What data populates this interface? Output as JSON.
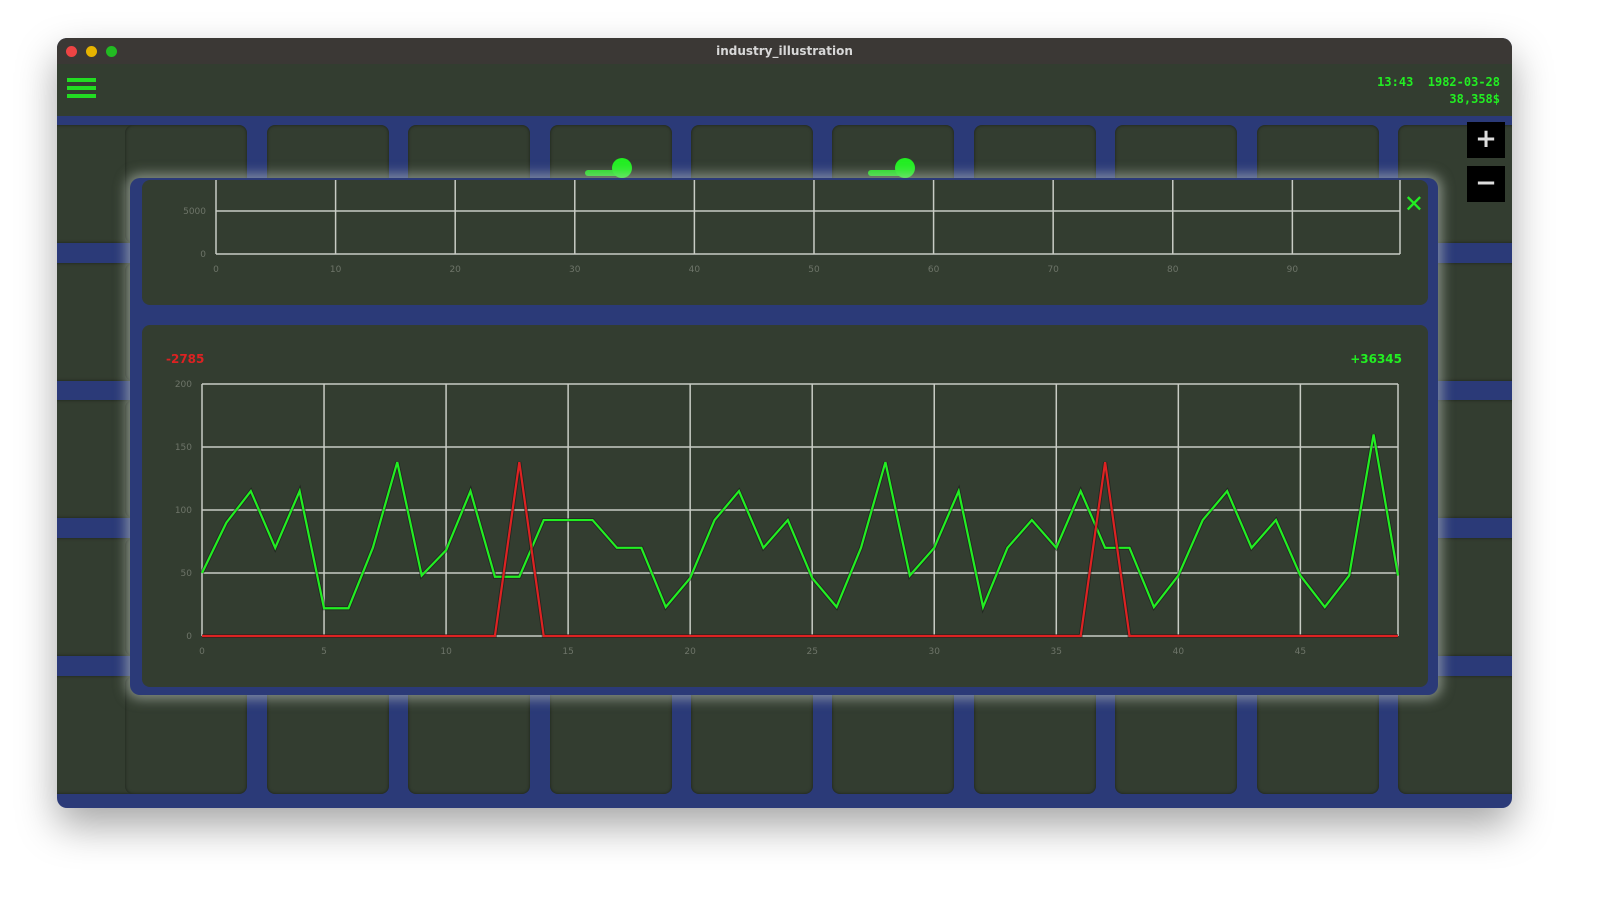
{
  "window": {
    "title": "industry_illustration"
  },
  "header": {
    "time": "13:43",
    "date": "1982-03-28",
    "balance": "38,358$",
    "menu_icon": "hamburger-icon"
  },
  "zoom": {
    "in_label": "+",
    "out_label": "−"
  },
  "overlay": {
    "close_label": "✕"
  },
  "colors": {
    "accent": "#22ee22",
    "negative": "#dd2222",
    "background": "#2b3a78",
    "panel": "#333d30"
  },
  "chart_data": [
    {
      "type": "line",
      "x_ticks": [
        0,
        10,
        20,
        30,
        40,
        50,
        60,
        70,
        80,
        90
      ],
      "y_ticks": [
        0,
        5000
      ],
      "xlim": [
        0,
        99
      ],
      "ylim": [
        0,
        5000
      ],
      "grid": true,
      "series": []
    },
    {
      "type": "line",
      "label_left": "-2785",
      "label_right": "+36345",
      "x_ticks": [
        0,
        5,
        10,
        15,
        20,
        25,
        30,
        35,
        40,
        45
      ],
      "y_ticks": [
        0,
        50,
        100,
        150,
        200
      ],
      "xlim": [
        0,
        49
      ],
      "ylim": [
        0,
        200
      ],
      "grid": true,
      "series": [
        {
          "color": "#22ee22",
          "values": [
            50,
            90,
            115,
            70,
            115,
            22,
            22,
            70,
            138,
            48,
            68,
            115,
            47,
            47,
            92,
            92,
            92,
            70,
            70,
            23,
            46,
            92,
            115,
            70,
            92,
            46,
            23,
            70,
            138,
            48,
            70,
            115,
            23,
            70,
            92,
            70,
            115,
            70,
            70,
            23,
            48,
            92,
            115,
            70,
            92,
            48,
            23,
            48,
            160,
            48
          ]
        },
        {
          "color": "#dd2222",
          "values": [
            0,
            0,
            0,
            0,
            0,
            0,
            0,
            0,
            0,
            0,
            0,
            0,
            0,
            138,
            0,
            0,
            0,
            0,
            0,
            0,
            0,
            0,
            0,
            0,
            0,
            0,
            0,
            0,
            0,
            0,
            0,
            0,
            0,
            0,
            0,
            0,
            0,
            138,
            0,
            0,
            0,
            0,
            0,
            0,
            0,
            0,
            0,
            0,
            0,
            0
          ]
        }
      ]
    }
  ]
}
